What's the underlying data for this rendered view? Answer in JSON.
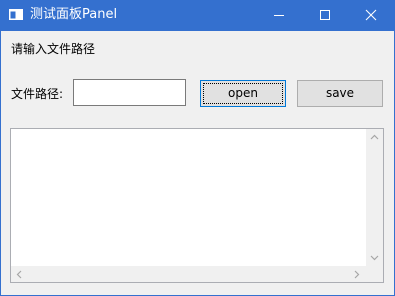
{
  "window": {
    "title": "测试面板Panel",
    "icon": "window-app-icon",
    "controls": [
      "minimize-icon",
      "maximize-icon",
      "close-icon"
    ]
  },
  "form": {
    "prompt": "请输入文件路径",
    "path_label": "文件路径:",
    "path_value": "",
    "open_label": "open",
    "save_label": "save"
  },
  "output": {
    "content": ""
  },
  "colors": {
    "titlebar": "#3470cf",
    "client_bg": "#f0f0f0",
    "focus_border": "#0078d7"
  }
}
